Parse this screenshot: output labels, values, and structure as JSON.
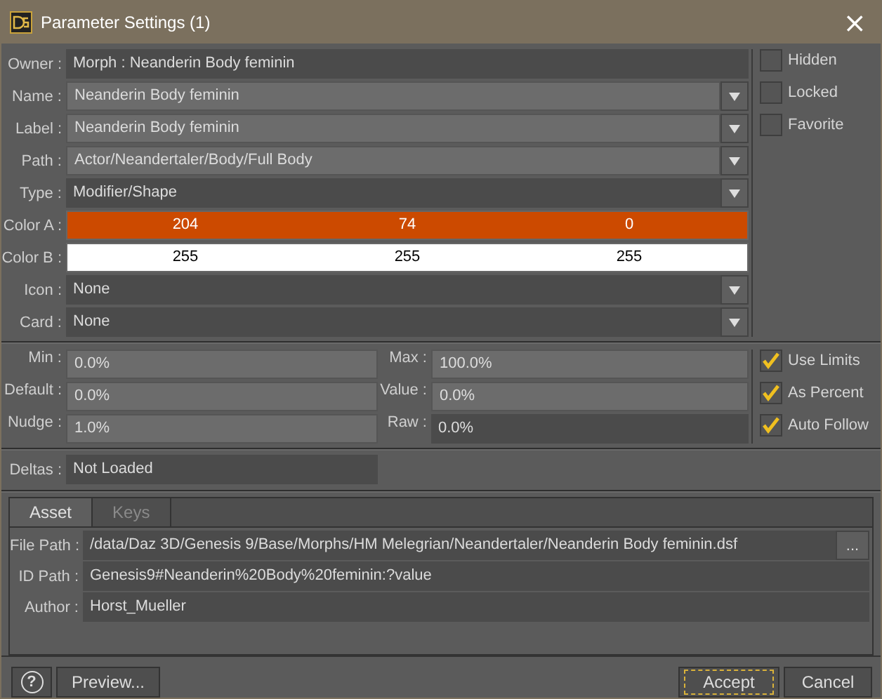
{
  "window": {
    "title": "Parameter Settings (1)",
    "close": "×"
  },
  "fields": [
    {
      "label": "Owner :",
      "kind": "readonly",
      "value": "Morph : Neanderin Body feminin"
    },
    {
      "label": "Name :",
      "kind": "combo",
      "value": "Neanderin Body feminin"
    },
    {
      "label": "Label :",
      "kind": "combo",
      "value": "Neanderin Body feminin"
    },
    {
      "label": "Path :",
      "kind": "combo",
      "value": "Actor/Neandertaler/Body/Full Body"
    },
    {
      "label": "Type :",
      "kind": "dropdown",
      "value": "Modifier/Shape"
    },
    {
      "label": "Color A :",
      "kind": "color",
      "color": "#cc4a00",
      "channels": [
        "204",
        "74",
        "0"
      ]
    },
    {
      "label": "Color B :",
      "kind": "color",
      "color": "#ffffff",
      "channels": [
        "255",
        "255",
        "255"
      ]
    },
    {
      "label": "Icon :",
      "kind": "dropdown",
      "value": "None"
    },
    {
      "label": "Card :",
      "kind": "dropdown",
      "value": "None"
    }
  ],
  "flags": [
    {
      "label": "Hidden",
      "checked": false
    },
    {
      "label": "Locked",
      "checked": false
    },
    {
      "label": "Favorite",
      "checked": false
    }
  ],
  "values": [
    {
      "label": "Min :",
      "value": "0.0%",
      "editable": true
    },
    {
      "label": "Max :",
      "value": "100.0%",
      "editable": true
    },
    {
      "label": "Default :",
      "value": "0.0%",
      "editable": true
    },
    {
      "label": "Value :",
      "value": "0.0%",
      "editable": true
    },
    {
      "label": "Nudge :",
      "value": "1.0%",
      "editable": true
    },
    {
      "label": "Raw :",
      "value": "0.0%",
      "editable": false
    }
  ],
  "options": [
    {
      "label": "Use Limits",
      "checked": true
    },
    {
      "label": "As Percent",
      "checked": true
    },
    {
      "label": "Auto Follow",
      "checked": true
    }
  ],
  "deltas": {
    "label": "Deltas :",
    "value": "Not Loaded"
  },
  "tabs": [
    {
      "label": "Asset",
      "selected": true
    },
    {
      "label": "Keys",
      "selected": false
    }
  ],
  "asset": [
    {
      "label": "File Path :",
      "value": "/data/Daz 3D/Genesis 9/Base/Morphs/HM Melegrian/Neandertaler/Neanderin Body feminin.dsf",
      "browse": "..."
    },
    {
      "label": "ID Path :",
      "value": "Genesis9#Neanderin%20Body%20feminin:?value"
    },
    {
      "label": "Author :",
      "value": "Horst_Mueller"
    }
  ],
  "buttons": {
    "help": "?",
    "preview": "Preview...",
    "accept": "Accept",
    "cancel": "Cancel"
  }
}
